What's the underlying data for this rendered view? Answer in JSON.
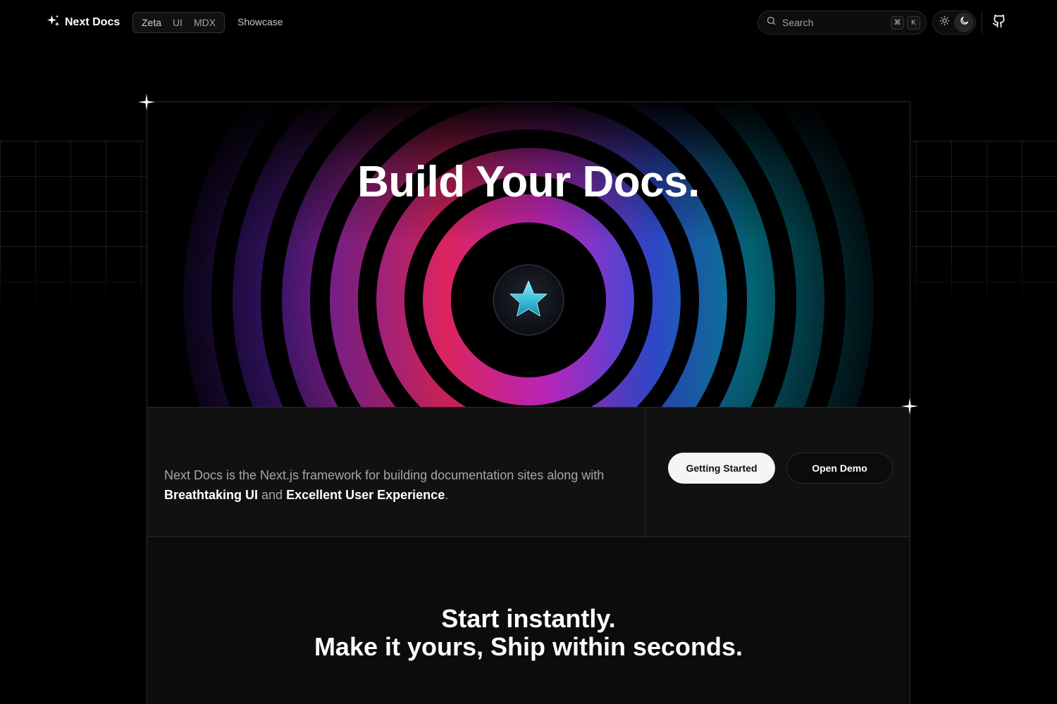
{
  "nav": {
    "brand": "Next Docs",
    "groups": [
      "Zeta",
      "UI",
      "MDX"
    ],
    "links": [
      "Showcase"
    ],
    "search": {
      "placeholder": "Search",
      "shortcut": [
        "⌘",
        "K"
      ]
    },
    "theme": {
      "options": [
        "light",
        "dark"
      ],
      "active": "dark"
    },
    "icons": {
      "brand": "sparkles-icon",
      "search": "search-icon",
      "light": "sun-icon",
      "dark": "moon-icon",
      "repo": "github-icon"
    }
  },
  "hero": {
    "title": "Build Your Docs.",
    "center_icon": "star-icon",
    "colors": {
      "pink": "#ff2a6d",
      "magenta": "#d42bd6",
      "purple": "#7b2ff7",
      "cyan": "#06b6d4",
      "blue": "#3b5bff"
    }
  },
  "intro": {
    "text_1": "Next Docs is the Next.js framework for building documentation sites along with ",
    "highlight_1": "Breathtaking UI",
    "text_2": " and ",
    "highlight_2": "Excellent User Experience",
    "text_3": ".",
    "primary_button": "Getting Started",
    "secondary_button": "Open Demo"
  },
  "features": {
    "line_1": "Start instantly.",
    "line_2": "Make it yours, Ship within seconds."
  }
}
